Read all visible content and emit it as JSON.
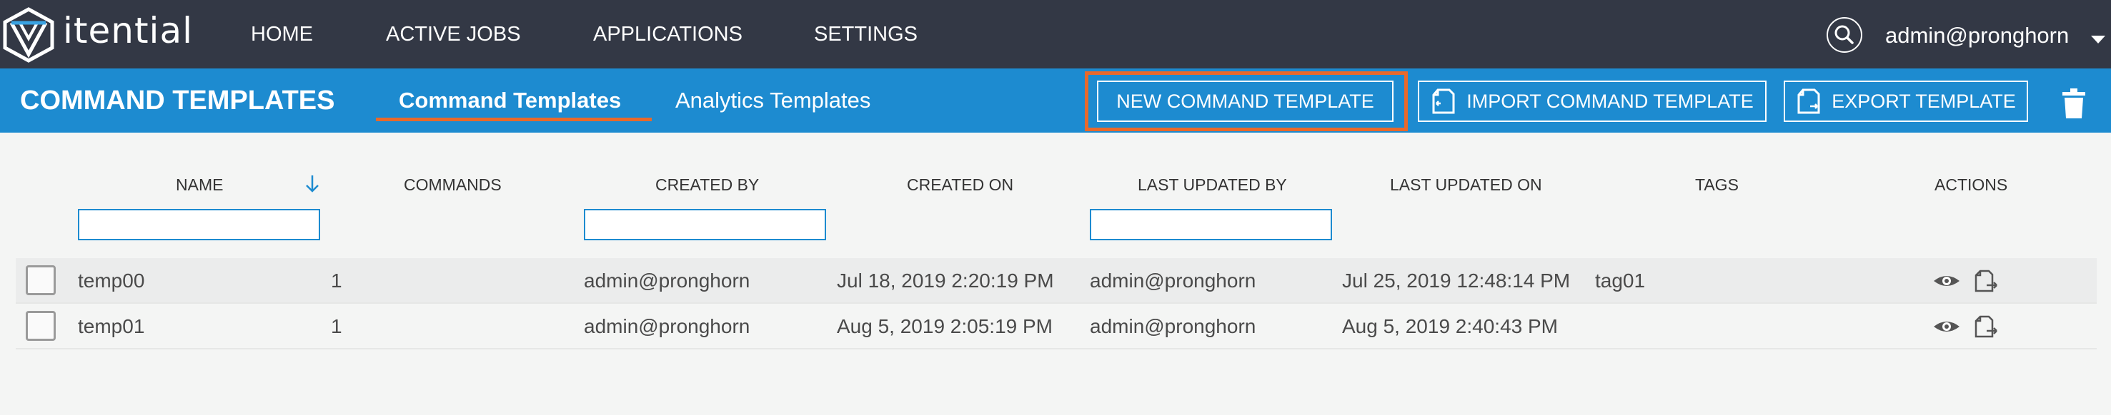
{
  "brand": {
    "logo_text": "itential"
  },
  "nav": {
    "items": [
      "HOME",
      "ACTIVE JOBS",
      "APPLICATIONS",
      "SETTINGS"
    ],
    "user": "admin@pronghorn"
  },
  "header": {
    "title": "COMMAND TEMPLATES",
    "tabs": [
      {
        "label": "Command Templates",
        "active": true
      },
      {
        "label": "Analytics Templates",
        "active": false
      }
    ],
    "buttons": {
      "new": "NEW COMMAND TEMPLATE",
      "import": "IMPORT COMMAND TEMPLATE",
      "export": "EXPORT TEMPLATE"
    }
  },
  "table": {
    "columns": [
      "NAME",
      "COMMANDS",
      "CREATED BY",
      "CREATED ON",
      "LAST UPDATED BY",
      "LAST UPDATED ON",
      "TAGS",
      "ACTIONS"
    ],
    "rows": [
      {
        "name": "temp00",
        "commands": "1",
        "created_by": "admin@pronghorn",
        "created_on": "Jul 18, 2019 2:20:19 PM",
        "updated_by": "admin@pronghorn",
        "updated_on": "Jul 25, 2019 12:48:14 PM",
        "tags": "tag01"
      },
      {
        "name": "temp01",
        "commands": "1",
        "created_by": "admin@pronghorn",
        "created_on": "Aug 5, 2019 2:05:19 PM",
        "updated_by": "admin@pronghorn",
        "updated_on": "Aug 5, 2019 2:40:43 PM",
        "tags": ""
      }
    ]
  },
  "colors": {
    "nav_bg": "#333845",
    "header_bg": "#1d8bd0",
    "accent": "#e8692b"
  }
}
